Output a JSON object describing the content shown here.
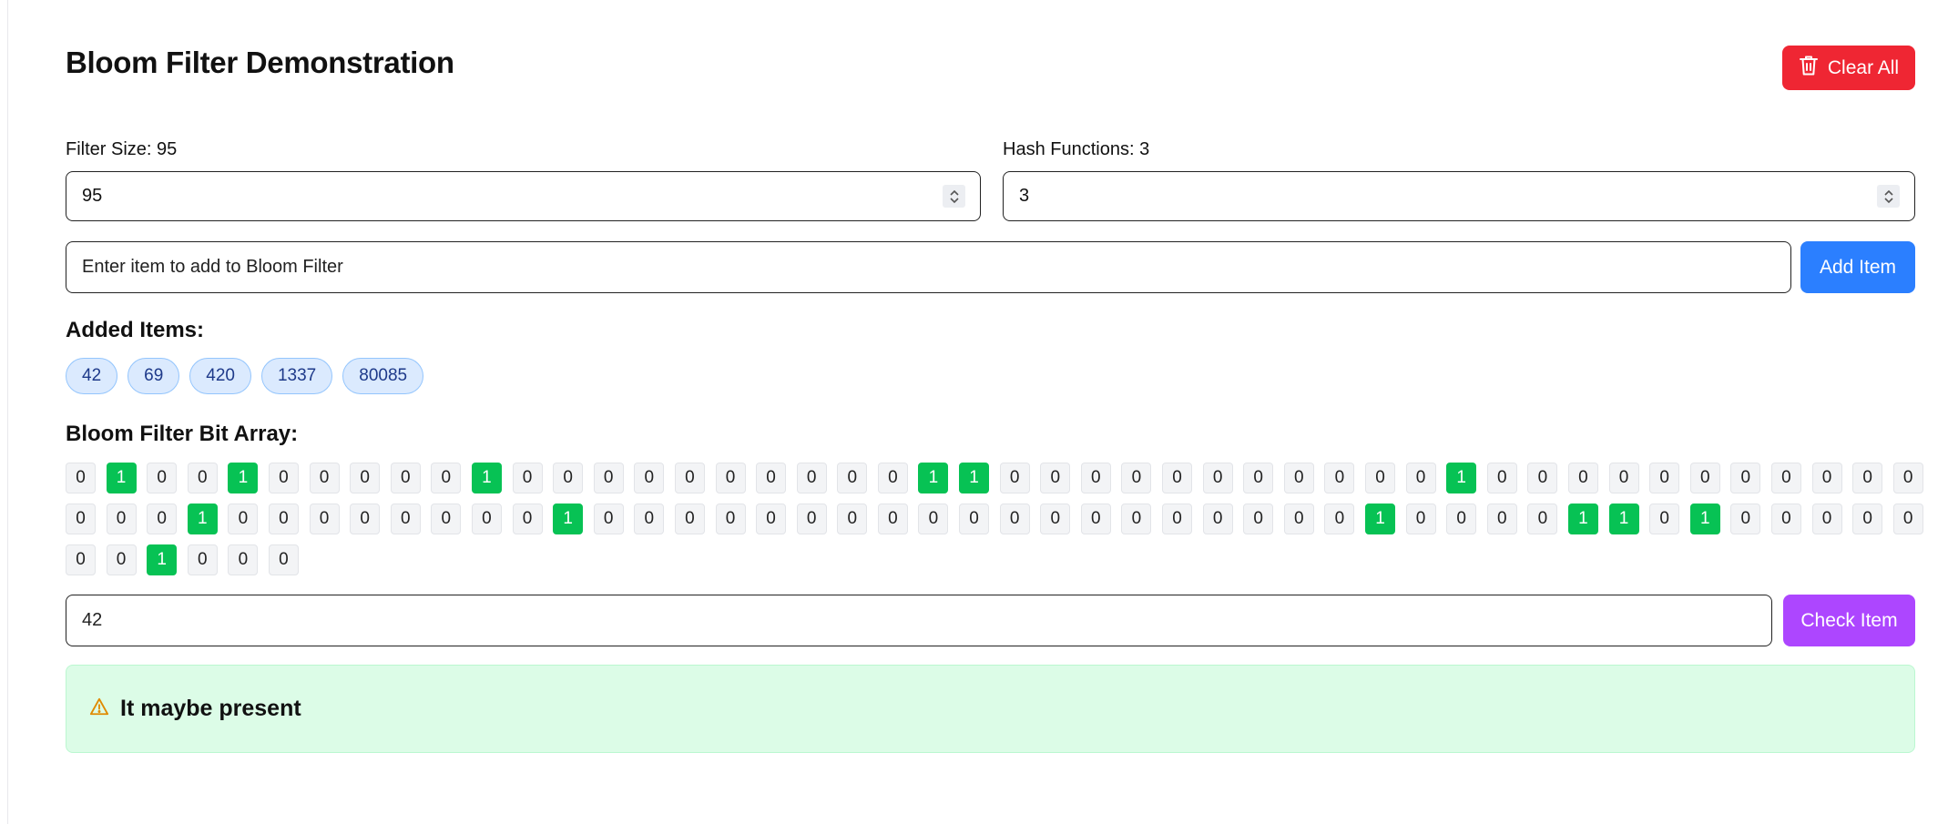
{
  "header": {
    "title": "Bloom Filter Demonstration",
    "clear_label": "Clear All"
  },
  "settings": {
    "size_label": "Filter Size: 95",
    "size_value": "95",
    "hash_label": "Hash Functions: 3",
    "hash_value": "3"
  },
  "add": {
    "placeholder": "Enter item to add to Bloom Filter",
    "button_label": "Add Item"
  },
  "added_items": {
    "heading": "Added Items:",
    "items": [
      "42",
      "69",
      "420",
      "1337",
      "80085"
    ]
  },
  "bit_array": {
    "heading": "Bloom Filter Bit Array:",
    "bits": [
      0,
      1,
      0,
      0,
      1,
      0,
      0,
      0,
      0,
      0,
      1,
      0,
      0,
      0,
      0,
      0,
      0,
      0,
      0,
      0,
      0,
      1,
      1,
      0,
      0,
      0,
      0,
      0,
      0,
      0,
      0,
      0,
      0,
      0,
      1,
      0,
      0,
      0,
      0,
      0,
      0,
      0,
      0,
      0,
      0,
      0,
      0,
      0,
      0,
      1,
      0,
      0,
      0,
      0,
      0,
      0,
      0,
      0,
      1,
      0,
      0,
      0,
      0,
      0,
      0,
      0,
      0,
      0,
      0,
      0,
      0,
      0,
      0,
      0,
      0,
      0,
      0,
      0,
      1,
      0,
      0,
      0,
      0,
      1,
      1,
      0,
      1,
      0,
      0,
      0,
      0,
      0,
      0,
      0,
      1,
      0,
      0,
      0
    ]
  },
  "check": {
    "value": "42",
    "button_label": "Check Item"
  },
  "result": {
    "message": "It maybe present",
    "icon": "warning-icon"
  },
  "colors": {
    "clear": "#ef2633",
    "add": "#2b7fff",
    "check": "#ad46ff",
    "bit_on": "#07c254",
    "result_bg": "#dcfce7"
  }
}
